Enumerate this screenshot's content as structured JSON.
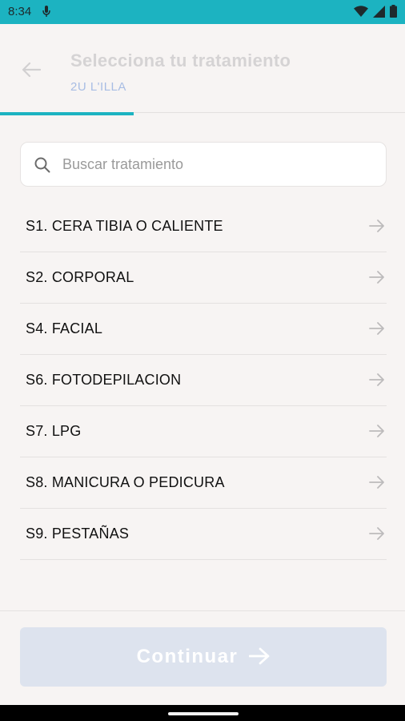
{
  "status_bar": {
    "time": "8:34",
    "icons": [
      "mic-icon",
      "wifi-icon",
      "signal-icon",
      "battery-icon"
    ],
    "bg_color": "#1cb3c1"
  },
  "header": {
    "title": "Selecciona tu tratamiento",
    "subtitle": "2U L'ILLA",
    "progress_fraction": 0.33
  },
  "search": {
    "placeholder": "Buscar tratamiento",
    "value": ""
  },
  "treatments": [
    {
      "label": "S1. CERA TIBIA O CALIENTE"
    },
    {
      "label": "S2. CORPORAL"
    },
    {
      "label": "S4. FACIAL"
    },
    {
      "label": "S6. FOTODEPILACION"
    },
    {
      "label": "S7. LPG"
    },
    {
      "label": "S8. MANICURA O PEDICURA"
    },
    {
      "label": "S9. PESTAÑAS"
    }
  ],
  "footer": {
    "continue_label": "Continuar"
  },
  "colors": {
    "accent": "#1cb3c1",
    "background": "#f7f4f3",
    "button_disabled": "#dde3ee",
    "subtitle": "#a8bde4"
  }
}
